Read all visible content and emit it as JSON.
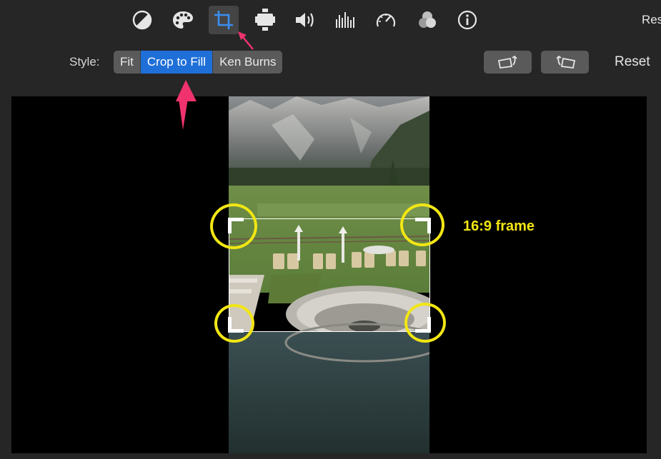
{
  "toolbar": {
    "tools": [
      {
        "name": "color-balance-icon",
        "active": false
      },
      {
        "name": "color-correction-icon",
        "active": false
      },
      {
        "name": "crop-icon",
        "active": true
      },
      {
        "name": "stabilization-icon",
        "active": false
      },
      {
        "name": "volume-icon",
        "active": false
      },
      {
        "name": "equalizer-icon",
        "active": false
      },
      {
        "name": "speed-icon",
        "active": false
      },
      {
        "name": "clip-filter-icon",
        "active": false
      },
      {
        "name": "info-icon",
        "active": false
      }
    ],
    "cut_label": "Res"
  },
  "style_row": {
    "label": "Style:",
    "options": [
      "Fit",
      "Crop to Fill",
      "Ken Burns"
    ],
    "selected": "Crop to Fill",
    "reset_label": "Reset"
  },
  "annotation": {
    "frame_label": "16:9 frame",
    "circle_color": "#f2e614",
    "arrow_color": "#f0336e"
  },
  "colors": {
    "background": "#262626",
    "selected": "#1f6fd8",
    "button": "#5a5a5a"
  }
}
